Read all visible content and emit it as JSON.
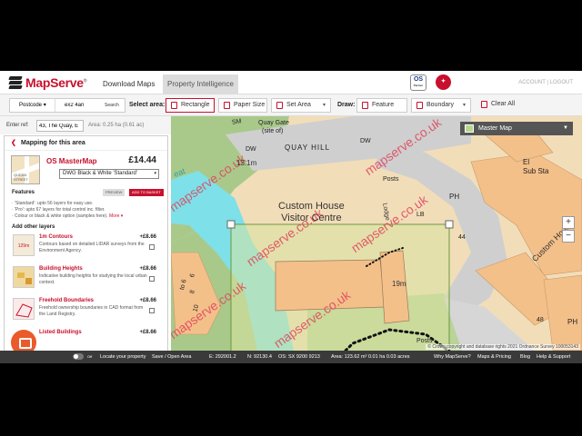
{
  "header": {
    "logo_text": "MapServe",
    "logo_tm": "®",
    "tabs": [
      {
        "label": "Download Maps"
      },
      {
        "label": "Property Intelligence"
      }
    ],
    "os_badge": "OS",
    "os_badge_sub": "Partner",
    "account": "ACCOUNT  |  LOGOUT"
  },
  "toolbar": {
    "postcode_select": "Postcode",
    "postcode_value": "ex2 4an",
    "search_label": "Search",
    "select_area_label": "Select area:",
    "rectangle_label": "Rectangle",
    "paper_size_label": "Paper Size",
    "set_area_label": "Set Area",
    "draw_label": "Draw:",
    "feature_label": "Feature",
    "boundary_label": "Boundary",
    "clear_all_label": "Clear All"
  },
  "refbar": {
    "label": "Enter ref:",
    "value": "43, The Quay, E",
    "area": "Area: 0.25 ha (0.61 ac)"
  },
  "panel": {
    "title": "Mapping for this area",
    "product": {
      "thumb_text": "QUEEN STREET",
      "name": "OS MasterMap",
      "price": "£14.44",
      "format": "DWG Black & White 'Standard'"
    },
    "features_label": "Features",
    "preview_label": "PREVIEW",
    "basket_label": "ADD TO BASKET",
    "features": [
      "· 'Standard': upto 56 layers for easy use.",
      "· 'Pro': upto 67 layers for total control inc. filter.",
      "· Colour or black & white option (samples here)."
    ],
    "more_label": "More ▾",
    "other_layers_label": "Add other layers",
    "layers": [
      {
        "thumb": "129m",
        "name": "1m Contours",
        "price": "+£8.66",
        "desc": "Contours based on detailed LIDAR surveys from the Environment Agency."
      },
      {
        "thumb": "",
        "name": "Building Heights",
        "price": "+£8.66",
        "desc": "Indicative building heights for studying the local urban context."
      },
      {
        "thumb": "",
        "name": "Freehold Boundaries",
        "price": "+£8.66",
        "desc": "Freehold ownership boundaries in CAD format from the Land Registry."
      },
      {
        "thumb": "",
        "name": "Listed Buildings",
        "price": "+£8.66",
        "desc": ""
      }
    ]
  },
  "map": {
    "layer_select": "Master Map",
    "zoom_in": "+",
    "zoom_out": "−",
    "watermark": "mapserve.co.uk",
    "labels": {
      "quay_gate": "Quay Gate",
      "site_of": "(site of)",
      "sm": "SM",
      "dw1": "DW",
      "quay_hill": "QUAY HILL",
      "dw2": "DW",
      "el_sub_sta": "El\nSub Sta",
      "posts_top": "Posts",
      "building": "Custom House\nVisitor Centre",
      "lodge": "Lodge",
      "lb": "LB",
      "ph1": "PH",
      "ph2": "PH",
      "no44": "44",
      "custom_house": "Custom House",
      "no48": "48",
      "dim1": "13.1m",
      "dim2": "19m",
      "posts_bottom": "Posts",
      "eat": "eat",
      "no8": "8",
      "no6": "6",
      "no10": "10",
      "to6": "to 6"
    },
    "copyright": "© Crown copyright and database rights 2021 Ordnance Survey 100053143"
  },
  "status": {
    "off_label": "Off",
    "locate_label": "Locate your property",
    "save_label": "Save / Open Area",
    "e_label": "E: 292001.2",
    "n_label": "N: 92130.4",
    "os_label": "OS: SX 9200 9213",
    "area_label": "Area: 123.62 m²   0.01 ha   0.03 acres",
    "why_label": "Why MapServe?",
    "maps_pricing_label": "Maps & Pricing",
    "blog_label": "Blog",
    "help_label": "Help & Support"
  }
}
